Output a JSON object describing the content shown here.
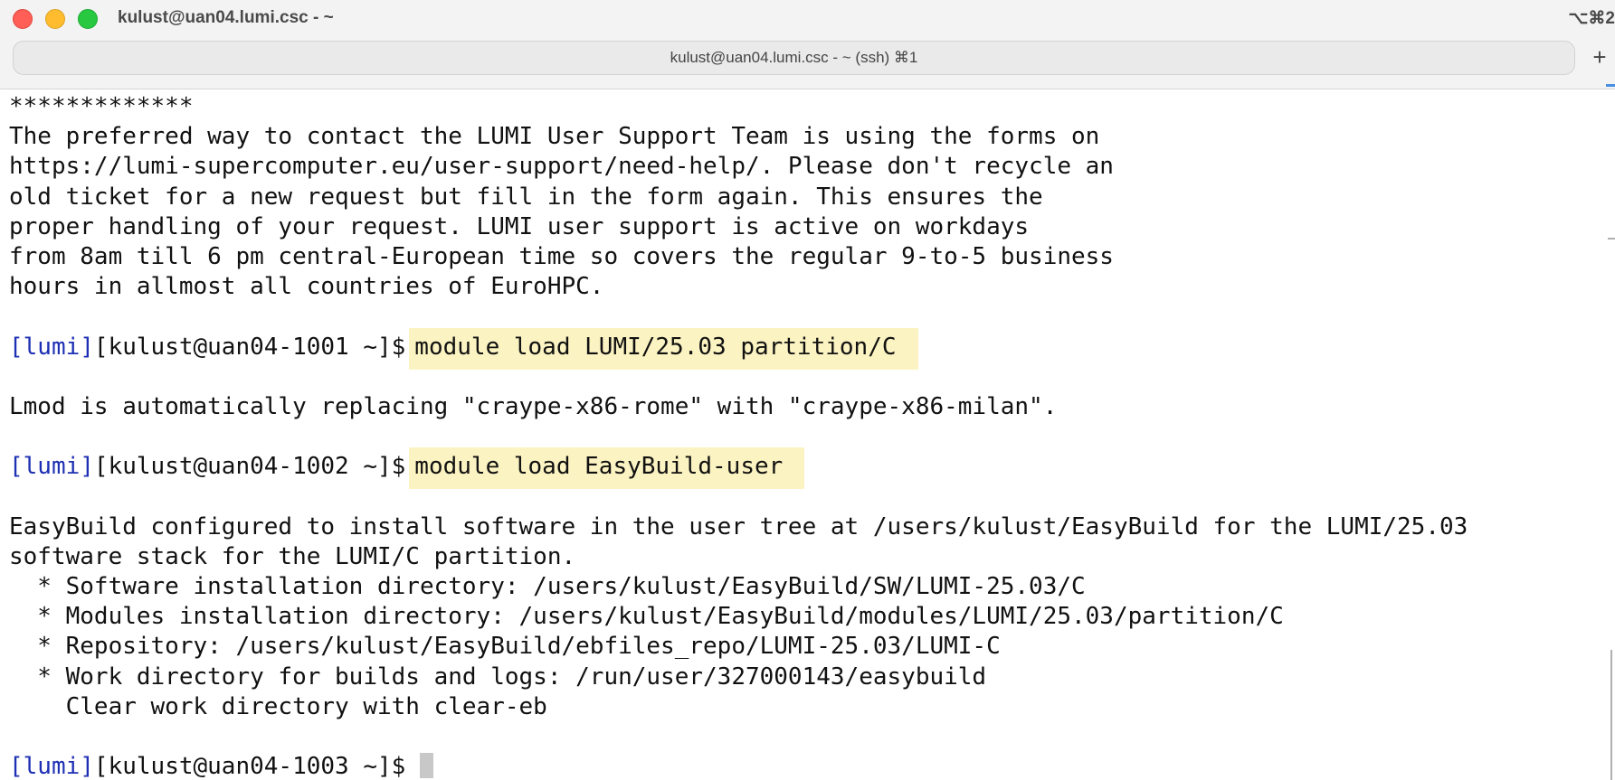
{
  "window": {
    "title": "kulust@uan04.lumi.csc - ~",
    "shortcut": "⌥⌘2"
  },
  "tabs": [
    {
      "label": "kulust@uan04.lumi.csc - ~ (ssh) ⌘1"
    }
  ],
  "new_tab_glyph": "+",
  "terminal": {
    "lines": {
      "stars": "*************",
      "motd1": "The preferred way to contact the LUMI User Support Team is using the forms on",
      "motd2": "https://lumi-supercomputer.eu/user-support/need-help/. Please don't recycle an",
      "motd3": "old ticket for a new request but fill in the form again. This ensures the",
      "motd4": "proper handling of your request. LUMI user support is active on workdays",
      "motd5": "from 8am till 6 pm central-European time so covers the regular 9-to-5 business",
      "motd6": "hours in allmost all countries of EuroHPC.",
      "lmod": "Lmod is automatically replacing \"craype-x86-rome\" with \"craype-x86-milan\".",
      "eb1": "EasyBuild configured to install software in the user tree at /users/kulust/EasyBuild for the LUMI/25.03",
      "eb2": "software stack for the LUMI/C partition.",
      "eb3": "  * Software installation directory: /users/kulust/EasyBuild/SW/LUMI-25.03/C",
      "eb4": "  * Modules installation directory: /users/kulust/EasyBuild/modules/LUMI/25.03/partition/C",
      "eb5": "  * Repository: /users/kulust/EasyBuild/ebfiles_repo/LUMI-25.03/LUMI-C",
      "eb6": "  * Work directory for builds and logs: /run/user/327000143/easybuild",
      "eb7": "    Clear work directory with clear-eb"
    },
    "prompts": [
      {
        "tag": "[lumi]",
        "host": "[kulust@uan04-1001 ~]$",
        "command": "module load LUMI/25.03 partition/C"
      },
      {
        "tag": "[lumi]",
        "host": "[kulust@uan04-1002 ~]$",
        "command": "module load EasyBuild-user"
      },
      {
        "tag": "[lumi]",
        "host": "[kulust@uan04-1003 ~]$",
        "command": ""
      }
    ]
  },
  "colors": {
    "prompt_tag": "#1d2fb3",
    "command_highlight": "#fbf3c2",
    "close": "#ff5f57",
    "minimize": "#febc2e",
    "maximize": "#28c840"
  }
}
